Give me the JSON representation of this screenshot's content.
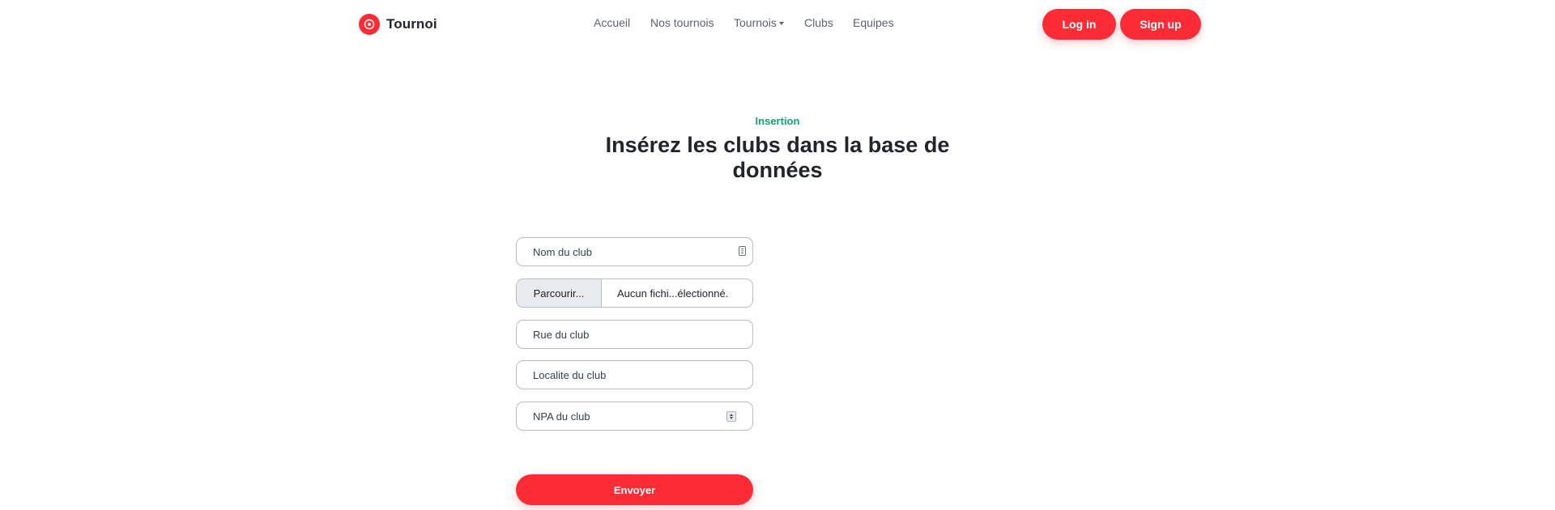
{
  "brand": {
    "name": "Tournoi",
    "logo_icon": "ball-icon",
    "accent": "#fc2c37"
  },
  "nav": {
    "items": [
      {
        "label": "Accueil"
      },
      {
        "label": "Nos tournois"
      },
      {
        "label": "Tournois",
        "has_dropdown": true
      },
      {
        "label": "Clubs"
      },
      {
        "label": "Equipes"
      }
    ],
    "login_label": "Log in",
    "signup_label": "Sign up"
  },
  "header": {
    "eyebrow": "Insertion",
    "eyebrow_color": "#14a46c",
    "title_line1": "Insérez les clubs dans la base de",
    "title_line2": "données"
  },
  "form": {
    "name_placeholder": "Nom du club",
    "file_button": "Parcourir...",
    "file_status": "Aucun fichi...électionné.",
    "street_placeholder": "Rue du club",
    "locality_placeholder": "Localite du club",
    "npa_placeholder": "NPA du club",
    "submit_label": "Envoyer"
  }
}
